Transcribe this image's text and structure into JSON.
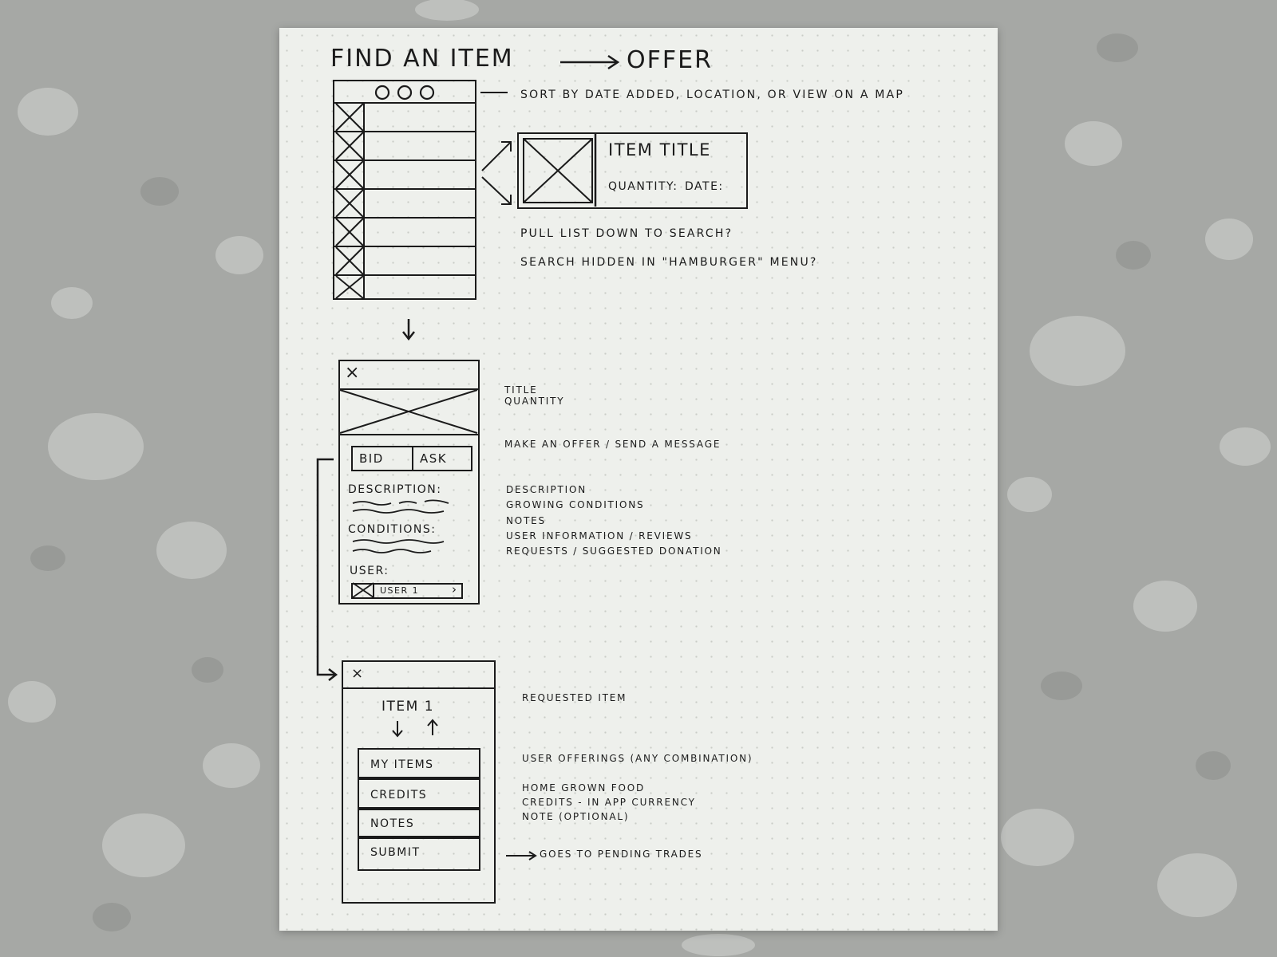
{
  "heading": {
    "title": "FIND AN ITEM",
    "target": "OFFER"
  },
  "list_screen": {
    "toolbar_icons": [
      "circle-icon",
      "circle-icon",
      "circle-icon"
    ],
    "row_count": 7
  },
  "list_item_detail": {
    "title": "ITEM TITLE",
    "quantity_label": "QUANTITY:",
    "date_label": "DATE:"
  },
  "notes_top": {
    "sort": "SORT BY DATE ADDED, LOCATION, OR VIEW ON A MAP",
    "pull": "PULL LIST DOWN TO SEARCH?",
    "search": "SEARCH HIDDEN IN \"HAMBURGER\" MENU?"
  },
  "detail_screen": {
    "close": "×",
    "bid": "BID",
    "ask": "ASK",
    "description_label": "DESCRIPTION:",
    "conditions_label": "CONDITIONS:",
    "user_label": "USER:",
    "user_name": "USER 1",
    "user_chevron": "›"
  },
  "notes_middle": {
    "title": "TITLE",
    "quantity": "QUANTITY",
    "offer": "MAKE AN OFFER / SEND A MESSAGE",
    "fields": [
      "DESCRIPTION",
      "GROWING CONDITIONS",
      "NOTES",
      "USER INFORMATION / REVIEWS",
      "REQUESTS / SUGGESTED DONATION"
    ]
  },
  "offer_screen": {
    "close": "×",
    "item_title": "ITEM 1",
    "options": [
      "MY ITEMS",
      "CREDITS",
      "NOTES",
      "SUBMIT"
    ]
  },
  "notes_bottom": {
    "requested": "REQUESTED ITEM",
    "offerings": "USER OFFERINGS (ANY COMBINATION)",
    "offer_types": [
      "HOME GROWN FOOD",
      "CREDITS - IN APP CURRENCY",
      "NOTE (OPTIONAL)"
    ],
    "submit_note": "GOES TO PENDING TRADES"
  },
  "colors": {
    "ink": "#1b1b1b",
    "paper": "#eef0ec",
    "background": "#a9aba8"
  }
}
